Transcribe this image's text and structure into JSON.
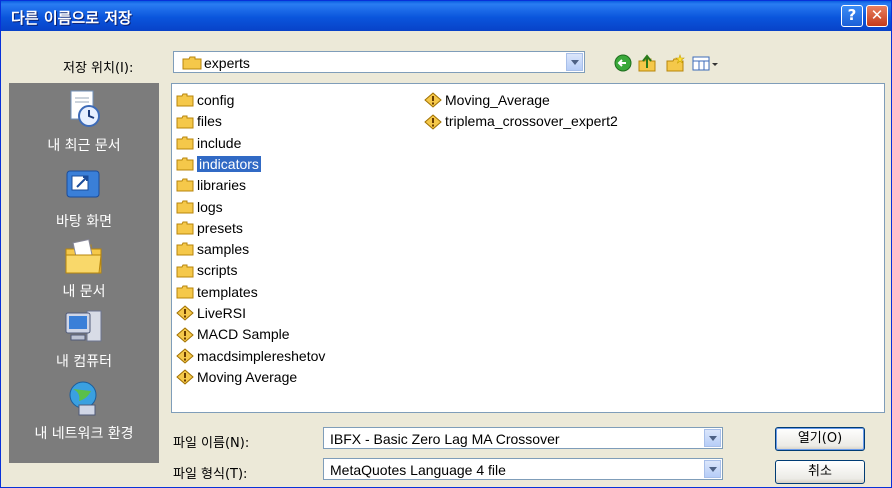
{
  "dialog": {
    "title": "다른 이름으로 저장",
    "help_label": "?",
    "close_label": "✕"
  },
  "location": {
    "label": "저장 위치(I):",
    "value": "experts"
  },
  "places": [
    {
      "label": "내 최근 문서",
      "icon": "recent-documents-icon"
    },
    {
      "label": "바탕 화면",
      "icon": "desktop-icon"
    },
    {
      "label": "내 문서",
      "icon": "my-documents-icon"
    },
    {
      "label": "내 컴퓨터",
      "icon": "my-computer-icon"
    },
    {
      "label": "내 네트워크 환경",
      "icon": "network-places-icon"
    }
  ],
  "files_col1": [
    {
      "name": "config",
      "type": "folder"
    },
    {
      "name": "files",
      "type": "folder"
    },
    {
      "name": "include",
      "type": "folder"
    },
    {
      "name": "indicators",
      "type": "folder",
      "selected": true
    },
    {
      "name": "libraries",
      "type": "folder"
    },
    {
      "name": "logs",
      "type": "folder"
    },
    {
      "name": "presets",
      "type": "folder"
    },
    {
      "name": "samples",
      "type": "folder"
    },
    {
      "name": "scripts",
      "type": "folder"
    },
    {
      "name": "templates",
      "type": "folder"
    },
    {
      "name": "LiveRSI",
      "type": "mq4"
    },
    {
      "name": "MACD Sample",
      "type": "mq4"
    },
    {
      "name": "macdsimplereshetov",
      "type": "mq4"
    },
    {
      "name": "Moving Average",
      "type": "mq4"
    }
  ],
  "files_col2": [
    {
      "name": "Moving_Average",
      "type": "mq4"
    },
    {
      "name": "triplema_crossover_expert2",
      "type": "mq4"
    }
  ],
  "filename": {
    "label": "파일 이름(N):",
    "value": "IBFX - Basic Zero Lag MA Crossover"
  },
  "filetype": {
    "label": "파일 형식(T):",
    "value": "MetaQuotes Language 4 file"
  },
  "buttons": {
    "open": "열기(O)",
    "cancel": "취소"
  },
  "colors": {
    "titlebar": "#0a55dc",
    "selection": "#316ac5",
    "places_bg": "#7c7c7c",
    "folder": "#f5c84a"
  }
}
